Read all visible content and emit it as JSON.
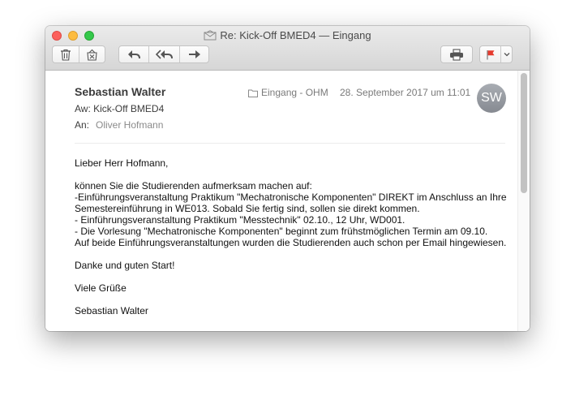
{
  "window": {
    "title": "Re: Kick-Off BMED4 — Eingang"
  },
  "toolbar": {
    "icons": [
      "trash-icon",
      "junk-icon",
      "reply-icon",
      "reply-all-icon",
      "forward-icon",
      "print-icon",
      "flag-icon",
      "chevron-down-icon"
    ],
    "flag_color": "#e53b2e"
  },
  "message": {
    "sender": "Sebastian Walter",
    "folder": "Eingang - OHM",
    "date": "28. September 2017 um 11:01",
    "avatar_initials": "SW",
    "subject_label": "Aw:",
    "subject": "Kick-Off BMED4",
    "to_label": "An:",
    "to": "Oliver Hofmann",
    "body": {
      "greeting": "Lieber Herr Hofmann,",
      "paragraph1": [
        "können Sie die Studierenden aufmerksam machen auf:",
        "-Einführungsveranstaltung Praktikum \"Mechatronische Komponenten\" DIREKT im Anschluss an Ihre",
        "Semestereinführung in WE013. Sobald Sie fertig sind, sollen sie direkt kommen.",
        "- Einführungsveranstaltung Praktikum \"Messtechnik\" 02.10., 12 Uhr, WD001.",
        "- Die Vorlesung \"Mechatronische Komponenten\" beginnt zum frühstmöglichen Termin am 09.10.",
        "Auf beide Einführungsveranstaltungen wurden die Studierenden auch schon per Email hingewiesen."
      ],
      "thanks": "Danke und guten Start!",
      "closing": "Viele Grüße",
      "signature": "Sebastian Walter"
    }
  }
}
